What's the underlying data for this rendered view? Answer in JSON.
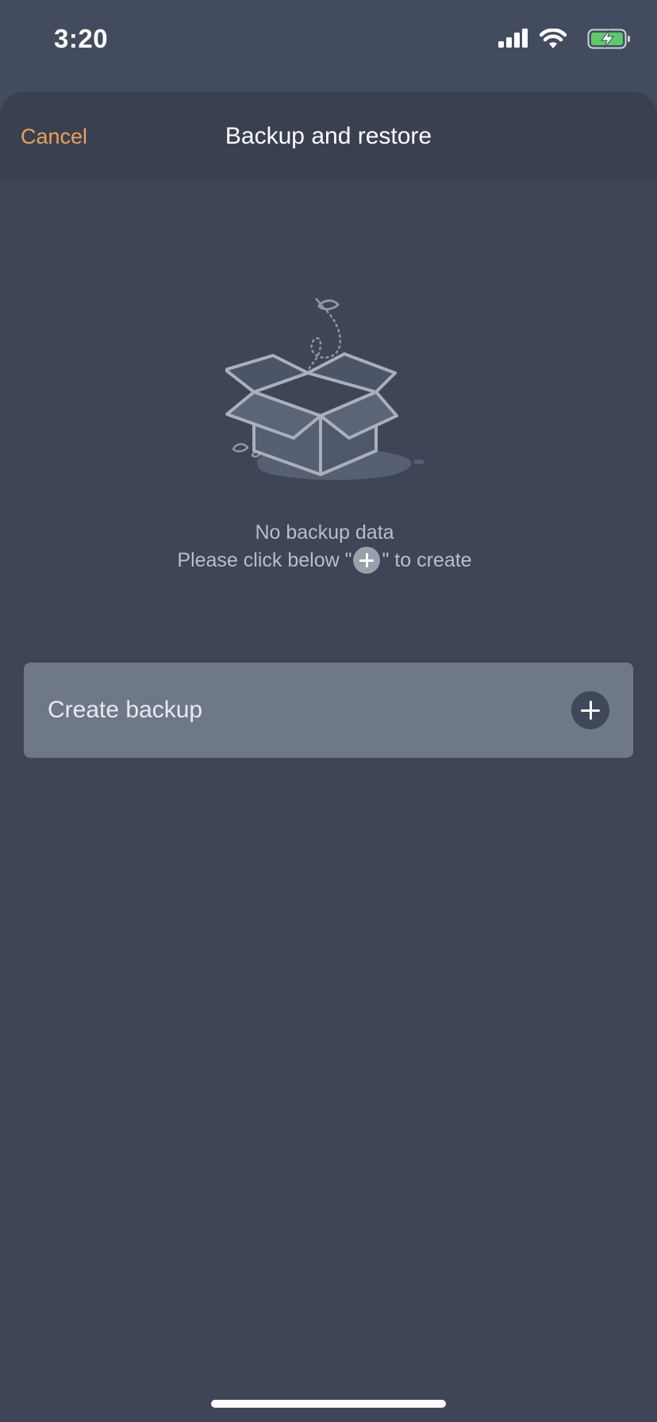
{
  "status_bar": {
    "time": "3:20",
    "icons": [
      "signal-icon",
      "wifi-icon",
      "battery-charging-icon"
    ],
    "battery_color": "#5cc96a"
  },
  "nav": {
    "cancel_label": "Cancel",
    "title": "Backup and restore"
  },
  "empty_state": {
    "illustration": "open-box-icon",
    "title": "No backup data",
    "hint_before": "Please click below \"",
    "hint_after": "\" to create"
  },
  "create_backup": {
    "label": "Create backup",
    "icon": "plus-circle-icon"
  },
  "colors": {
    "accent": "#e9a255",
    "background": "#3d4556",
    "row": "#6f7888"
  }
}
